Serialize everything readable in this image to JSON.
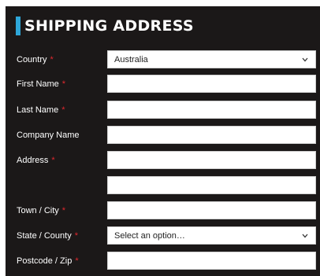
{
  "section": {
    "title": "SHIPPING ADDRESS",
    "accent_color": "#2ea6d8",
    "background_color": "#1b1818",
    "required_color": "#e0282e"
  },
  "fields": {
    "country": {
      "label": "Country",
      "required_mark": "*",
      "value": "Australia"
    },
    "first_name": {
      "label": "First Name",
      "required_mark": "*",
      "value": ""
    },
    "last_name": {
      "label": "Last Name",
      "required_mark": "*",
      "value": ""
    },
    "company_name": {
      "label": "Company Name",
      "value": ""
    },
    "address": {
      "label": "Address",
      "required_mark": "*",
      "line1_value": "",
      "line2_value": ""
    },
    "town_city": {
      "label": "Town / City",
      "required_mark": "*",
      "value": ""
    },
    "state_county": {
      "label": "State / County",
      "required_mark": "*",
      "value": "Select an option…"
    },
    "postcode_zip": {
      "label": "Postcode / Zip",
      "required_mark": "*",
      "value": ""
    }
  },
  "icons": {
    "select_arrow": "chevron-down-icon"
  }
}
